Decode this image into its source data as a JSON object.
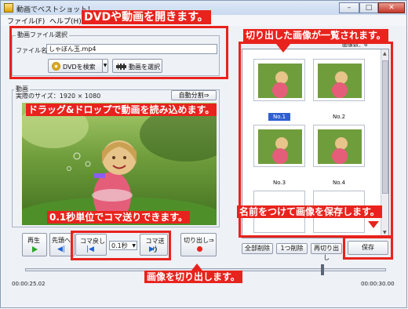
{
  "window": {
    "title": "動画でベストショット！",
    "controls": {
      "minimize": "–",
      "maximize": "□",
      "close": "✕"
    }
  },
  "menu": [
    "ファイル(F)",
    "ヘルプ(H)"
  ],
  "file_select": {
    "group_label": "動画ファイル選択",
    "filename_label": "ファイル名",
    "filename_value": "しゃぼん玉.mp4",
    "dvd_button": "DVDを検索",
    "video_button": "動画を選択"
  },
  "video": {
    "group_label": "動画",
    "size_label": "実際のサイズ",
    "size_value": "1920 × 1080",
    "auto_split": "自動分割⇒"
  },
  "controls": {
    "play": "再生",
    "first": "先頭へ",
    "prev_frame": "コマ戻し",
    "step_value": "0.1秒",
    "next_frame": "コマ送り",
    "cut_out": "切り出し⇒"
  },
  "timeline": {
    "start_time": "00:00:25.02",
    "end_time": "00:00:30.00"
  },
  "thumbnails": {
    "count_label": "画像数",
    "count_value": "6",
    "items": [
      "No.1",
      "No.2",
      "No.3",
      "No.4"
    ]
  },
  "list_buttons": {
    "delete_all": "全部削除",
    "delete_one": "1つ削除",
    "cut_out_list": "再切り出し",
    "save": "保存"
  },
  "callouts": {
    "open_dvd": "DVDや動画を開きます。",
    "drag_drop": "ドラッグ&ドロップで動画を読み込めます。",
    "frame_step": "0.1秒単位でコマ送りできます。",
    "cut_out_image": "画像を切り出します。",
    "list_images": "切り出した画像が一覧されます。",
    "save_images": "名前をつけて画像を保存します。"
  },
  "colors": {
    "accent_red": "#e8231d",
    "selection_blue": "#2f5fd1"
  }
}
